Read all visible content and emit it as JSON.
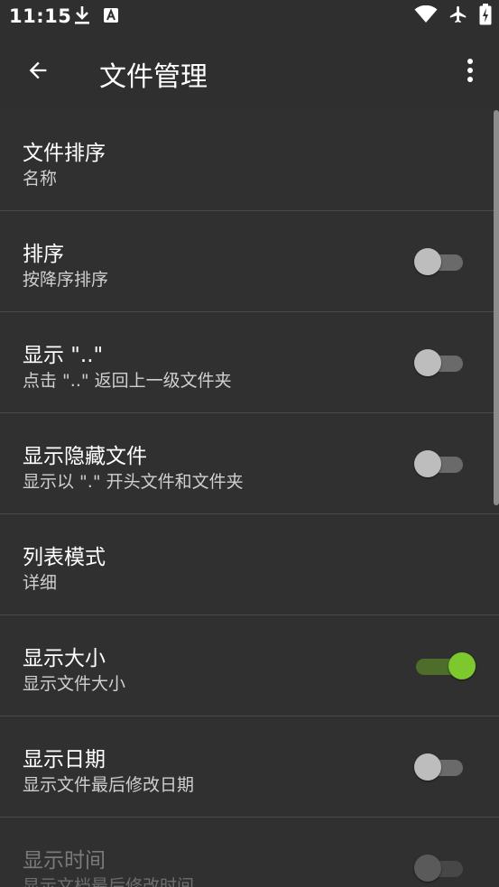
{
  "status_bar": {
    "time": "11:15",
    "left_icons": [
      "download-icon",
      "app-notification-icon"
    ],
    "right_icons": [
      "wifi-icon",
      "airplane-mode-icon",
      "battery-charging-icon"
    ]
  },
  "toolbar": {
    "title": "文件管理",
    "back_icon": "arrow-back-icon",
    "menu_icon": "more-vert-icon"
  },
  "preferences": [
    {
      "title": "文件排序",
      "summary": "名称",
      "has_switch": false
    },
    {
      "title": "排序",
      "summary": "按降序排序",
      "has_switch": true,
      "checked": false
    },
    {
      "title": "显示 \"..\"",
      "summary": "点击 \"..\" 返回上一级文件夹",
      "has_switch": true,
      "checked": false
    },
    {
      "title": "显示隐藏文件",
      "summary": "显示以 \".\" 开头文件和文件夹",
      "has_switch": true,
      "checked": false
    },
    {
      "title": "列表模式",
      "summary": "详细",
      "has_switch": false
    },
    {
      "title": "显示大小",
      "summary": "显示文件大小",
      "has_switch": true,
      "checked": true
    },
    {
      "title": "显示日期",
      "summary": "显示文件最后修改日期",
      "has_switch": true,
      "checked": false
    },
    {
      "title": "显示时间",
      "summary": "显示文档最后修改时间",
      "has_switch": true,
      "checked": false,
      "disabled": true
    }
  ],
  "colors": {
    "background": "#303030",
    "accent": "#7cc82d"
  }
}
